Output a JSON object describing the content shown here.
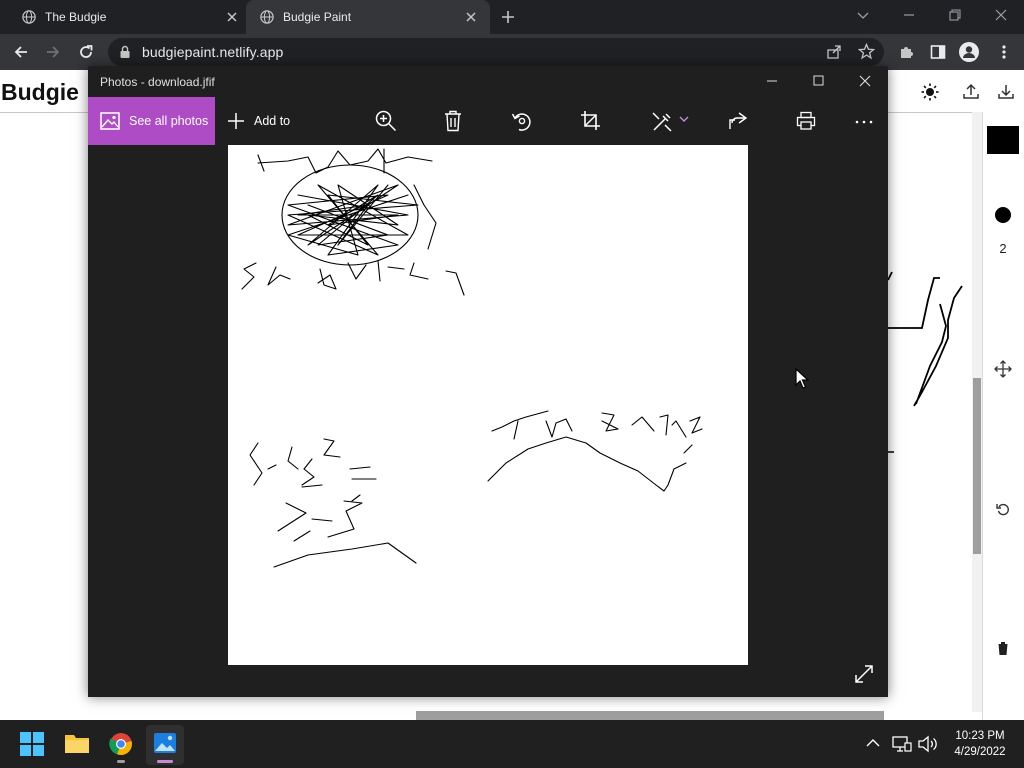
{
  "browser": {
    "tabs": [
      {
        "title": "The Budgie",
        "active": false
      },
      {
        "title": "Budgie Paint",
        "active": true
      }
    ],
    "url": "budgiepaint.netlify.app"
  },
  "page": {
    "title": "Budgie",
    "brush_size": "2",
    "current_color": "#000000"
  },
  "photos": {
    "window_title": "Photos - download.jfif",
    "see_all_label": "See all photos",
    "add_to_label": "Add to",
    "accent": "#ad4cc5"
  },
  "taskbar": {
    "time": "10:23 PM",
    "date": "4/29/2022"
  }
}
